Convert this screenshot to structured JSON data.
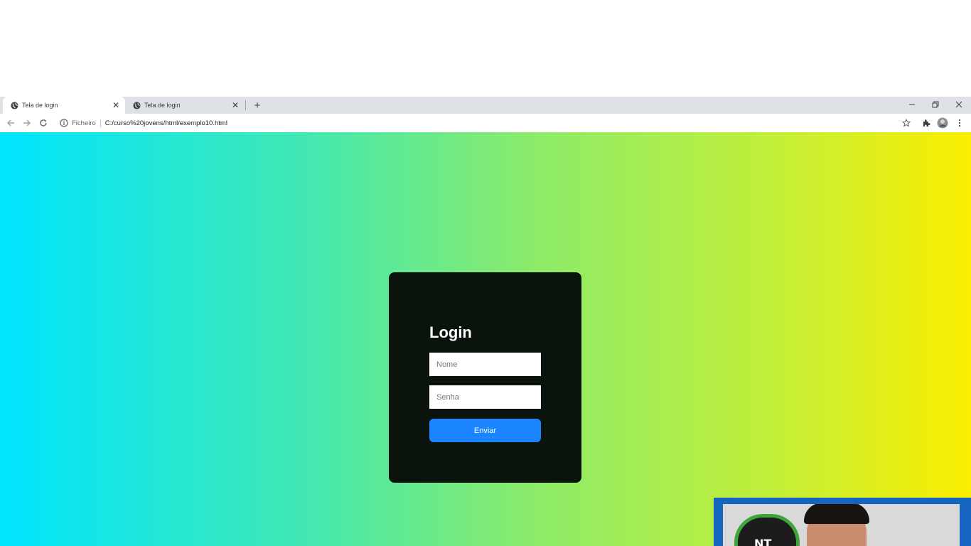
{
  "browser": {
    "tabs": [
      {
        "title": "Tela de login",
        "active": true
      },
      {
        "title": "Tela de login",
        "active": false
      }
    ],
    "omnibox": {
      "security_chip": "Ficheiro",
      "url": "C:/curso%20jovens/html/exemplo10.html"
    }
  },
  "login": {
    "heading": "Login",
    "name_placeholder": "Nome",
    "password_placeholder": "Senha",
    "submit_label": "Enviar"
  },
  "webcam": {
    "logo_text": "NT"
  },
  "colors": {
    "gradient_start": "#00e5ff",
    "gradient_end": "#fbee00",
    "card_bg": "#0a140c",
    "button_bg": "#1a85ff"
  }
}
